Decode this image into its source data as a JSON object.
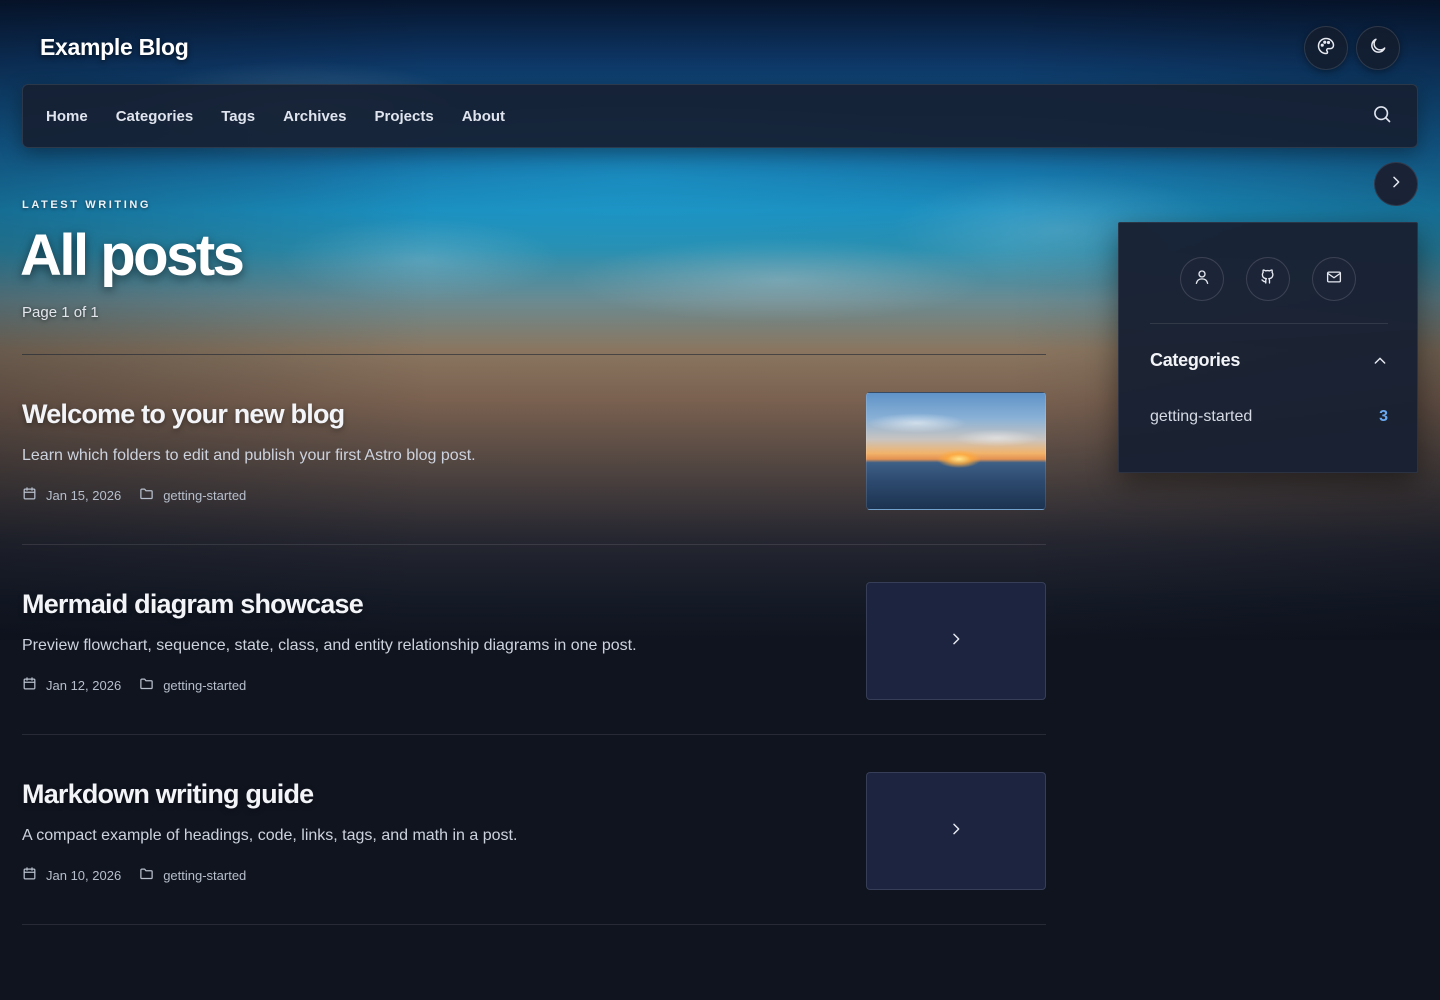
{
  "site": {
    "title": "Example Blog"
  },
  "nav": {
    "items": [
      {
        "label": "Home"
      },
      {
        "label": "Categories"
      },
      {
        "label": "Tags"
      },
      {
        "label": "Archives"
      },
      {
        "label": "Projects"
      },
      {
        "label": "About"
      }
    ],
    "search_icon": "search-icon"
  },
  "header_actions": {
    "theme_icon": "palette-icon",
    "mode_icon": "moon-icon"
  },
  "hero": {
    "eyebrow": "LATEST WRITING",
    "title": "All posts",
    "page_counter": "Page 1 of 1"
  },
  "posts": [
    {
      "title": "Welcome to your new blog",
      "description": "Learn which folders to edit and publish your first Astro blog post.",
      "date": "Jan 15, 2026",
      "category": "getting-started",
      "thumbnail": "sunset-image"
    },
    {
      "title": "Mermaid diagram showcase",
      "description": "Preview flowchart, sequence, state, class, and entity relationship diagrams in one post.",
      "date": "Jan 12, 2026",
      "category": "getting-started",
      "thumbnail": "chevron-right-icon"
    },
    {
      "title": "Markdown writing guide",
      "description": "A compact example of headings, code, links, tags, and math in a post.",
      "date": "Jan 10, 2026",
      "category": "getting-started",
      "thumbnail": "chevron-right-icon"
    }
  ],
  "sidebar": {
    "social": [
      "user-icon",
      "github-icon",
      "mail-icon"
    ],
    "categories_title": "Categories",
    "categories": [
      {
        "name": "getting-started",
        "count": "3"
      }
    ]
  },
  "colors": {
    "background": "#10141f",
    "accent": "#6aa9f0",
    "card": "#182032"
  }
}
